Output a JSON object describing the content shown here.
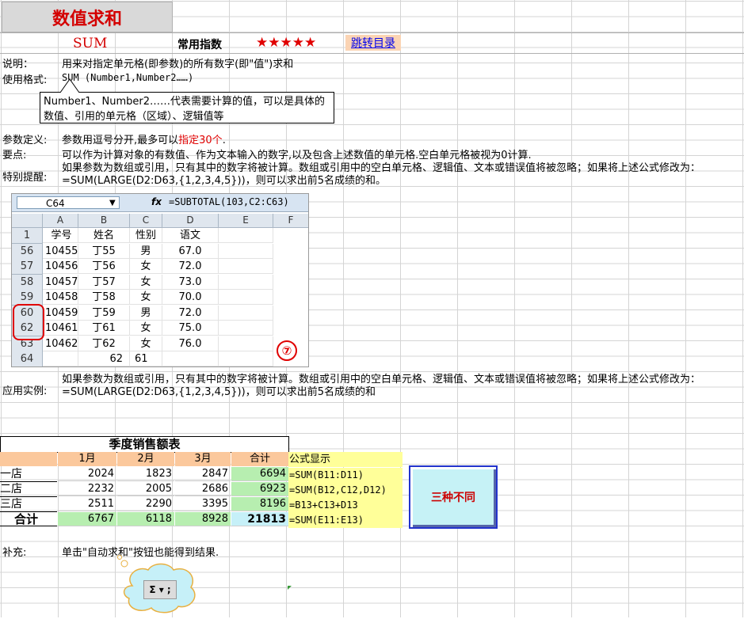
{
  "header": {
    "title": "数值求和",
    "func_name": "SUM",
    "freq_label": "常用指数",
    "stars": "★★★★★",
    "jump_link": "跳转目录"
  },
  "rows": {
    "desc_label": "说明：",
    "desc_text": "用来对指定单元格(即参数)的所有数字(即\"值\")求和",
    "format_label": "使用格式:",
    "format_text": "SUM (Number1,Number2……)",
    "callout": "Number1、Number2……代表需要计算的值，可以是具体的数值、引用的单元格（区域）、逻辑值等",
    "param_label": "参数定义:",
    "param_text": "参数用逗号分开,最多可以",
    "param_red": "指定30个",
    "param_end": ".",
    "key_label": "要点:",
    "key_text": "可以作为计算对象的有数值、作为文本输入的数字,以及包含上述数值的单元格.空白单元格被视为0计算.",
    "special_label": "特别提醒:",
    "special_text": "如果参数为数组或引用，只有其中的数字将被计算。数组或引用中的空白单元格、逻辑值、文本或错误值将被忽略；如果将上述公式修改为：=SUM(LARGE(D2:D63,{1,2,3,4,5}))，则可以求出前5名成绩的和。",
    "example_label": "应用实例:",
    "example_text": "如果参数为数组或引用，只有其中的数字将被计算。数组或引用中的空白单元格、逻辑值、文本或错误值将被忽略；如果将上述公式修改为：=SUM(LARGE(D2:D63,{1,2,3,4,5}))，则可以求出前5名成绩的和",
    "supp_label": "补充:",
    "supp_text": "单击\"自动求和\"按钮也能得到结果."
  },
  "shot": {
    "name_box": "C64",
    "fx": "fx",
    "formula": "=SUBTOTAL(103,C2:C63)",
    "col_headers": [
      "A",
      "B",
      "C",
      "D",
      "E",
      "F"
    ],
    "rows": [
      {
        "n": "1",
        "a": "学号",
        "b": "姓名",
        "c": "性别",
        "d": "语文"
      },
      {
        "n": "56",
        "a": "10455",
        "b": "丁55",
        "c": "男",
        "d": "67.0"
      },
      {
        "n": "57",
        "a": "10456",
        "b": "丁56",
        "c": "女",
        "d": "72.0"
      },
      {
        "n": "58",
        "a": "10457",
        "b": "丁57",
        "c": "女",
        "d": "73.0"
      },
      {
        "n": "59",
        "a": "10458",
        "b": "丁58",
        "c": "女",
        "d": "70.0"
      },
      {
        "n": "60",
        "a": "10459",
        "b": "丁59",
        "c": "男",
        "d": "72.0"
      },
      {
        "n": "62",
        "a": "10461",
        "b": "丁61",
        "c": "女",
        "d": "75.0"
      },
      {
        "n": "63",
        "a": "10462",
        "b": "丁62",
        "c": "女",
        "d": "76.0"
      },
      {
        "n": "64",
        "a": "",
        "b": "62",
        "c": "61",
        "d": ""
      }
    ],
    "marker": "⑦"
  },
  "sales": {
    "title": "季度销售额表",
    "headers": [
      "",
      "1月",
      "2月",
      "3月",
      "合计"
    ],
    "formula_header": "公式显示",
    "rows": [
      {
        "store": "一店",
        "m1": "2024",
        "m2": "1823",
        "m3": "2847",
        "total": "6694",
        "formula": "=SUM(B11:D11)"
      },
      {
        "store": "二店",
        "m1": "2232",
        "m2": "2005",
        "m3": "2686",
        "total": "6923",
        "formula": "=SUM(B12,C12,D12)"
      },
      {
        "store": "三店",
        "m1": "2511",
        "m2": "2290",
        "m3": "3395",
        "total": "8196",
        "formula": "=B13+C13+D13"
      }
    ],
    "total_row": {
      "store": "合计",
      "m1": "6767",
      "m2": "6118",
      "m3": "8928",
      "total": "21813",
      "formula": "=SUM(E11:E13)"
    },
    "three_diff": "三种不同"
  },
  "toolbar": {
    "autosum_label": "Σ ▾ ;"
  }
}
